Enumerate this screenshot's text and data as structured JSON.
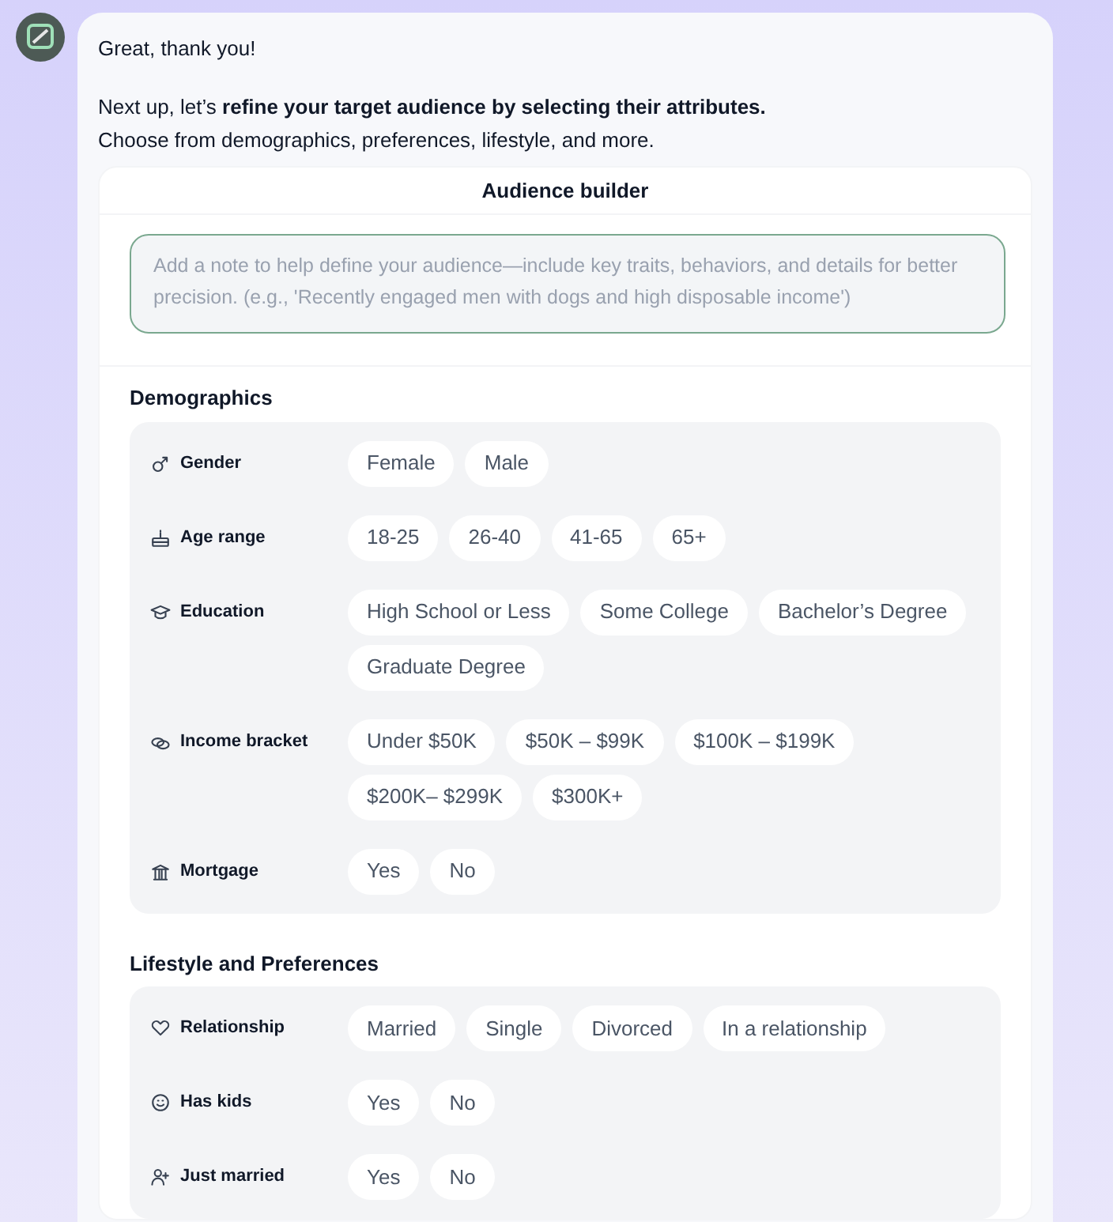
{
  "message": {
    "greeting": "Great, thank you!",
    "intro": "Next up, let’s **refine your target audience by selecting their attributes.**",
    "subline": "Choose from demographics, preferences, lifestyle, and more."
  },
  "builder": {
    "title": "Audience builder",
    "note": {
      "placeholder": "Add a note to help define your audience—include key traits, behaviors, and details for better precision. (e.g., 'Recently engaged men with dogs and high disposable income')"
    },
    "sections": [
      {
        "title": "Demographics",
        "attributes": [
          {
            "label": "Gender",
            "options": [
              "Female",
              "Male"
            ]
          },
          {
            "label": "Age range",
            "options": [
              "18-25",
              "26-40",
              "41-65",
              "65+"
            ]
          },
          {
            "label": "Education",
            "options": [
              "High School or Less",
              "Some College",
              "Bachelor’s Degree",
              "Graduate Degree"
            ]
          },
          {
            "label": "Income bracket",
            "options": [
              "Under $50K",
              "$50K – $99K",
              "$100K – $199K",
              "$200K– $299K",
              "$300K+"
            ]
          },
          {
            "label": "Mortgage",
            "options": [
              "Yes",
              "No"
            ]
          }
        ]
      },
      {
        "title": "Lifestyle and Preferences",
        "attributes": [
          {
            "label": "Relationship",
            "options": [
              "Married",
              "Single",
              "Divorced",
              "In a relationship"
            ]
          },
          {
            "label": "Has kids",
            "options": [
              "Yes",
              "No"
            ]
          },
          {
            "label": "Just married",
            "options": [
              "Yes",
              "No"
            ]
          }
        ]
      }
    ]
  }
}
